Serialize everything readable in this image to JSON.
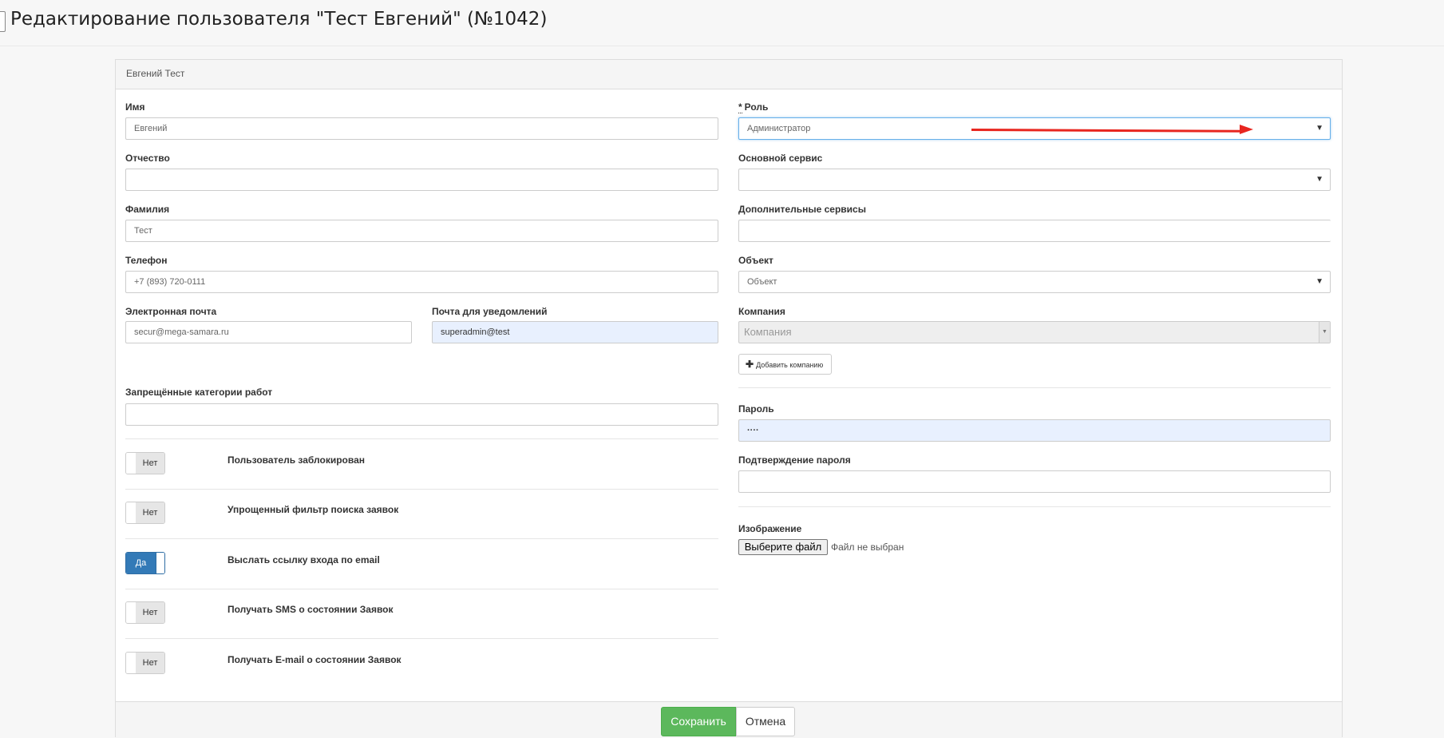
{
  "page": {
    "title": "Редактирование пользователя \"Тест Евгений\" (№1042)"
  },
  "panel": {
    "heading": "Евгений Тест"
  },
  "left": {
    "first_name": {
      "label": "Имя",
      "value": "Евгений"
    },
    "middle_name": {
      "label": "Отчество",
      "value": ""
    },
    "last_name": {
      "label": "Фамилия",
      "value": "Тест"
    },
    "phone": {
      "label": "Телефон",
      "value": "+7 (893) 720-0111"
    },
    "email": {
      "label": "Электронная почта",
      "value": "secur@mega-samara.ru"
    },
    "notify_email": {
      "label": "Почта для уведомлений",
      "value": "superadmin@test"
    },
    "forbidden_categories": {
      "label": "Запрещённые категории работ",
      "value": ""
    },
    "toggles": [
      {
        "label": "Пользователь заблокирован",
        "state": "Нет",
        "on": false
      },
      {
        "label": "Упрощенный фильтр поиска заявок",
        "state": "Нет",
        "on": false
      },
      {
        "label": "Выслать ссылку входа по email",
        "state": "Да",
        "on": true
      },
      {
        "label": "Получать SMS о состоянии Заявок",
        "state": "Нет",
        "on": false
      },
      {
        "label": "Получать E-mail о состоянии Заявок",
        "state": "Нет",
        "on": false
      }
    ]
  },
  "right": {
    "role": {
      "required_mark": "*",
      "label": "Роль",
      "value": "Администратор"
    },
    "main_service": {
      "label": "Основной сервис",
      "value": ""
    },
    "extra_services": {
      "label": "Дополнительные сервисы",
      "value": ""
    },
    "object": {
      "label": "Объект",
      "value": "Объект"
    },
    "company": {
      "label": "Компания",
      "placeholder": "Компания"
    },
    "add_company_label": "Добавить компанию",
    "password": {
      "label": "Пароль",
      "value": "····"
    },
    "password_confirm": {
      "label": "Подтверждение пароля",
      "value": ""
    },
    "image": {
      "label": "Изображение",
      "button": "Выберите файл",
      "status": "Файл не выбран"
    }
  },
  "footer": {
    "save": "Сохранить",
    "cancel": "Отмена"
  },
  "annotation": {
    "arrow_color": "#e8261f"
  }
}
